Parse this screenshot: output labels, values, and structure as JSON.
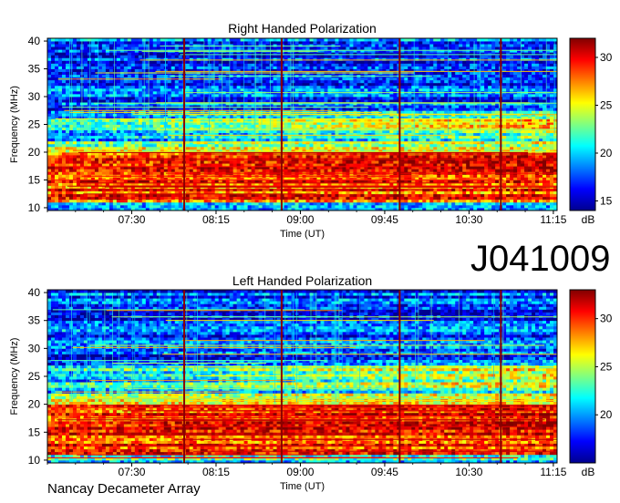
{
  "figure": {
    "identifier": "J041009",
    "footer": "Nancay Decameter Array"
  },
  "chart_data": [
    {
      "type": "heatmap",
      "title": "Right Handed Polarization",
      "xlabel": "Time (UT)",
      "ylabel": "Frequency (MHz)",
      "xticks": [
        "07:30",
        "08:15",
        "09:00",
        "09:45",
        "10:30",
        "11:15"
      ],
      "xtick_minutes": [
        450,
        495,
        540,
        585,
        630,
        675
      ],
      "xlim_minutes": [
        405,
        677
      ],
      "yticks": [
        10,
        15,
        20,
        25,
        30,
        35,
        40
      ],
      "ylim": [
        9.5,
        40.5
      ],
      "colorbar": {
        "label": "dB",
        "ticks": [
          15,
          20,
          25,
          30
        ],
        "range": [
          14,
          32
        ]
      },
      "interference_lines_time": [
        "07:58",
        "08:50",
        "09:53",
        "10:47"
      ]
    },
    {
      "type": "heatmap",
      "title": "Left Handed Polarization",
      "xlabel": "Time (UT)",
      "ylabel": "Frequency (MHz)",
      "xticks": [
        "07:30",
        "08:15",
        "09:00",
        "09:45",
        "10:30",
        "11:15"
      ],
      "xtick_minutes": [
        450,
        495,
        540,
        585,
        630,
        675
      ],
      "xlim_minutes": [
        405,
        677
      ],
      "yticks": [
        10,
        15,
        20,
        25,
        30,
        35,
        40
      ],
      "ylim": [
        9.5,
        40.5
      ],
      "colorbar": {
        "label": "dB",
        "ticks": [
          20,
          25,
          30
        ],
        "range": [
          15,
          33
        ]
      },
      "interference_lines_time": [
        "07:58",
        "08:50",
        "09:53",
        "10:47"
      ]
    }
  ],
  "colors": {
    "colormap": [
      "#00008f",
      "#0000ff",
      "#0080ff",
      "#00ffff",
      "#80ff80",
      "#ffff00",
      "#ff8000",
      "#ff0000",
      "#800000"
    ],
    "axis": "#000000",
    "interference_line": "#8a0000"
  }
}
